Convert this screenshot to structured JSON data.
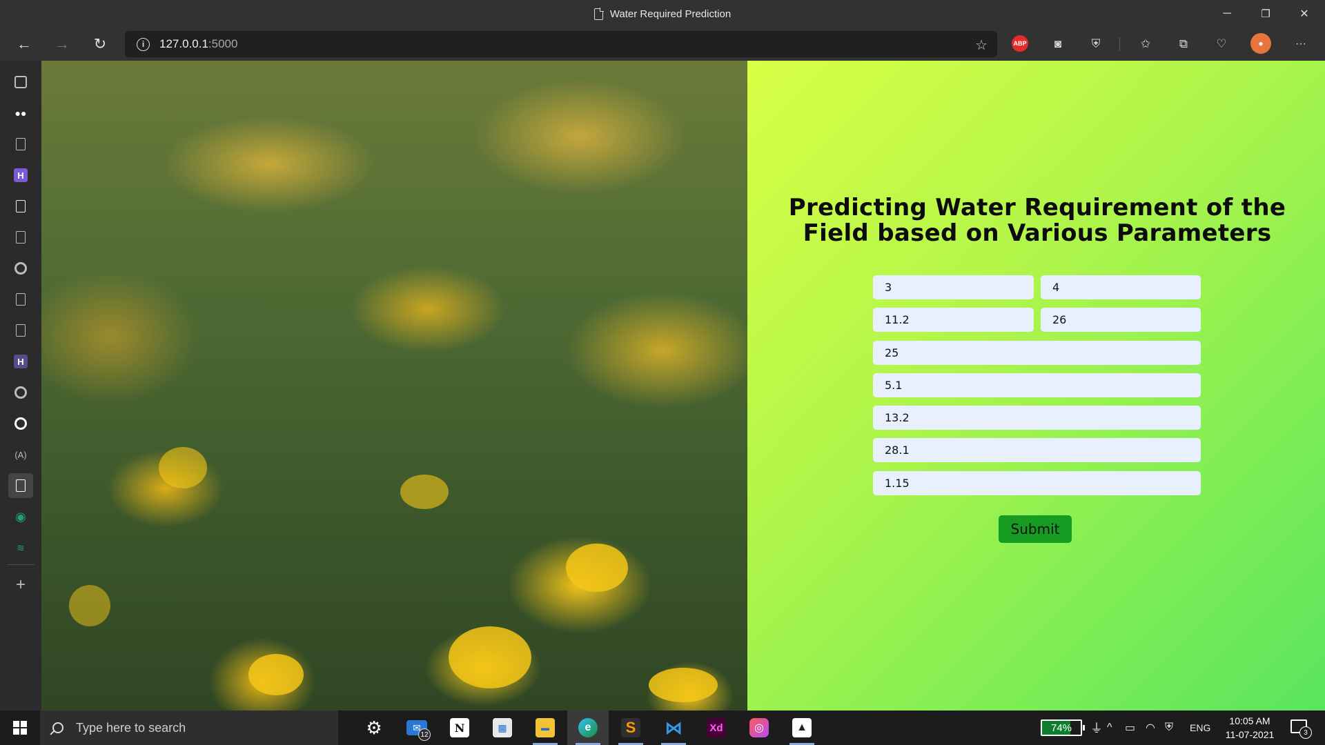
{
  "window": {
    "title": "Water Required Prediction",
    "minimize": "─",
    "restore": "❐",
    "close": "✕"
  },
  "navbar": {
    "back": "←",
    "forward": "→",
    "refresh": "↻",
    "info": "i",
    "url_host": "127.0.0.1",
    "url_port": ":5000",
    "more": "···"
  },
  "extensions": {
    "abp_label": "ABP"
  },
  "page": {
    "heading": "Predicting Water Requirement of the Field based on Various Parameters",
    "fields": [
      "3",
      "4",
      "11.2",
      "26",
      "25",
      "5.1",
      "13.2",
      "28.1",
      "1.15"
    ],
    "submit_label": "Submit"
  },
  "taskbar": {
    "search_placeholder": "Type here to search",
    "mail_badge": "12",
    "battery_level": "74%",
    "language": "ENG",
    "time": "10:05 AM",
    "date": "11-07-2021",
    "notification_count": "3"
  },
  "colors": {
    "panel_gradient_start": "#d8ff45",
    "panel_gradient_end": "#5ae45f",
    "field_bg": "#e8f0fe",
    "submit_bg": "#169c22",
    "battery_fill": "#0e7d2c"
  }
}
